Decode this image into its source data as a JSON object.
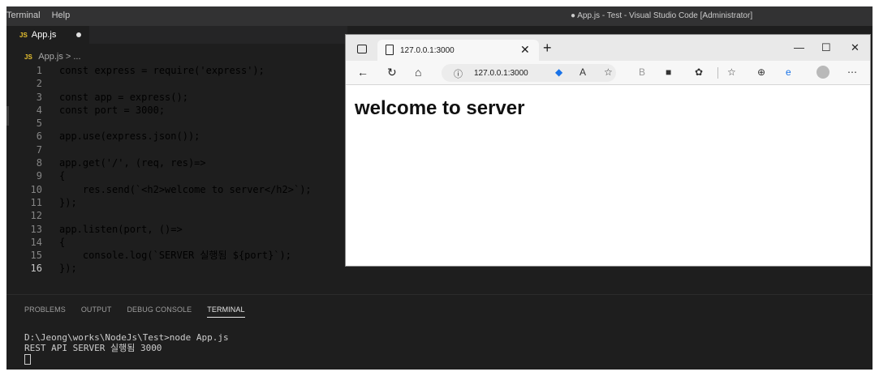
{
  "vscode": {
    "menu": [
      "Terminal",
      "Help"
    ],
    "window_title": "● App.js - Test - Visual Studio Code [Administrator]",
    "tab": {
      "icon": "JS",
      "label": "App.js",
      "modified": true
    },
    "breadcrumb": {
      "icon": "JS",
      "text": "App.js > ..."
    },
    "code_lines": [
      "const express = require('express');",
      "",
      "const app = express();",
      "const port = 3000;",
      "",
      "app.use(express.json());",
      "",
      "app.get('/', (req, res)=>",
      "{",
      "    res.send(`<h2>welcome to server</h2>`);",
      "});",
      "",
      "app.listen(port, ()=>",
      "{",
      "    console.log(`SERVER 실행됨 ${port}`);",
      "});"
    ],
    "line_numbers": [
      "1",
      "2",
      "3",
      "4",
      "5",
      "6",
      "7",
      "8",
      "9",
      "10",
      "11",
      "12",
      "13",
      "14",
      "15",
      "16"
    ],
    "active_line": 16,
    "panel_tabs": [
      "PROBLEMS",
      "OUTPUT",
      "DEBUG CONSOLE",
      "TERMINAL"
    ],
    "active_panel_tab": "TERMINAL",
    "terminal_lines": [
      "D:\\Jeong\\works\\NodeJs\\Test>node App.js",
      "REST API SERVER 실행됨 3000"
    ]
  },
  "browser": {
    "tab_title": "127.0.0.1:3000",
    "address": "127.0.0.1:3000",
    "page_heading": "welcome to server",
    "window_controls": [
      "—",
      "☐",
      "✕"
    ]
  },
  "colors": {
    "editor_bg": "#1e1e1e",
    "keyword": "#569cd6",
    "string": "#ce9178",
    "function": "#dcdcaa"
  }
}
